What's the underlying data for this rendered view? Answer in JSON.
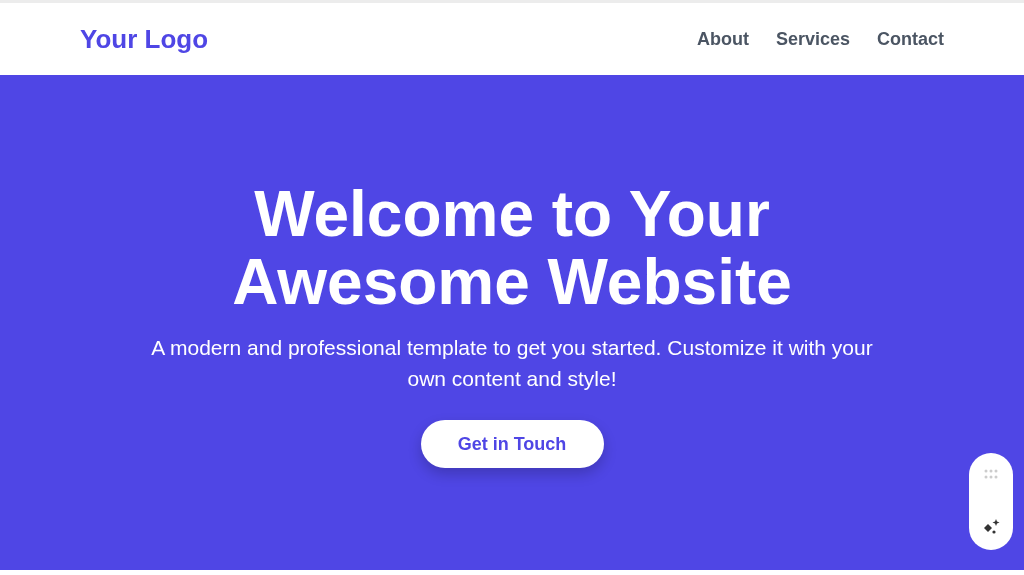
{
  "header": {
    "logo": "Your Logo",
    "nav": [
      {
        "label": "About"
      },
      {
        "label": "Services"
      },
      {
        "label": "Contact"
      }
    ]
  },
  "hero": {
    "title": "Welcome to Your Awesome Website",
    "subtitle": "A modern and professional template to get you started. Customize it with your own content and style!",
    "button": "Get in Touch"
  }
}
